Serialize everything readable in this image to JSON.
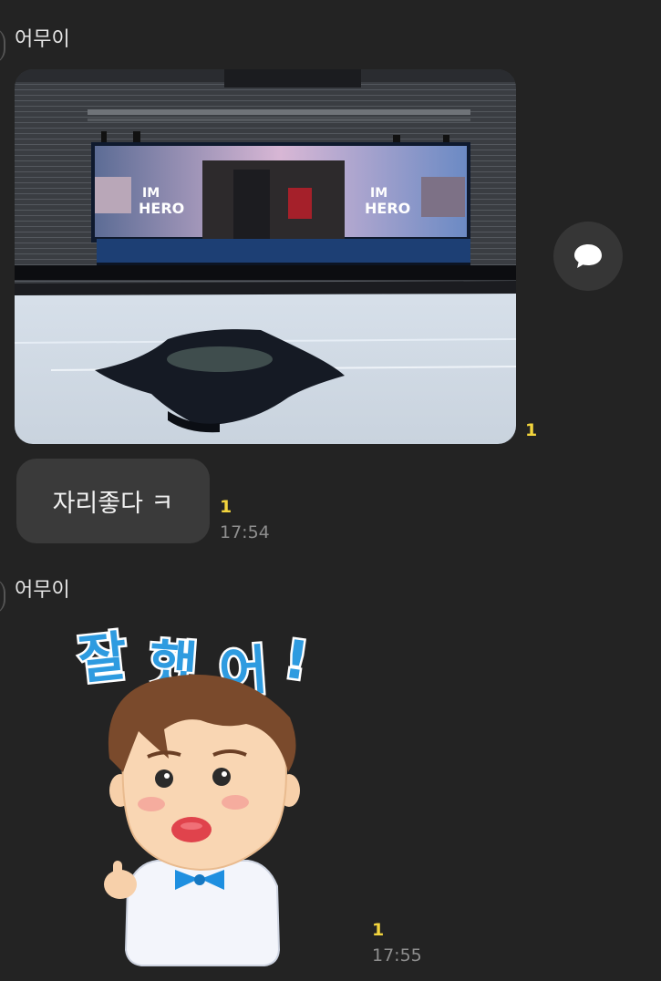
{
  "messages": [
    {
      "sender": "어무이",
      "type": "photo",
      "unread": "1"
    },
    {
      "type": "text",
      "text": "자리좋다 ㅋ",
      "unread": "1",
      "time": "17:54"
    },
    {
      "sender": "어무이",
      "type": "sticker",
      "sticker_text": "잘 했 어 !",
      "unread": "1",
      "time": "17:55"
    }
  ],
  "icons": {
    "share": "speech-bubble-icon"
  },
  "colors": {
    "background": "#232323",
    "bubble": "#3a3a3a",
    "unread": "#f2d43d",
    "time": "#8e8e8e"
  }
}
